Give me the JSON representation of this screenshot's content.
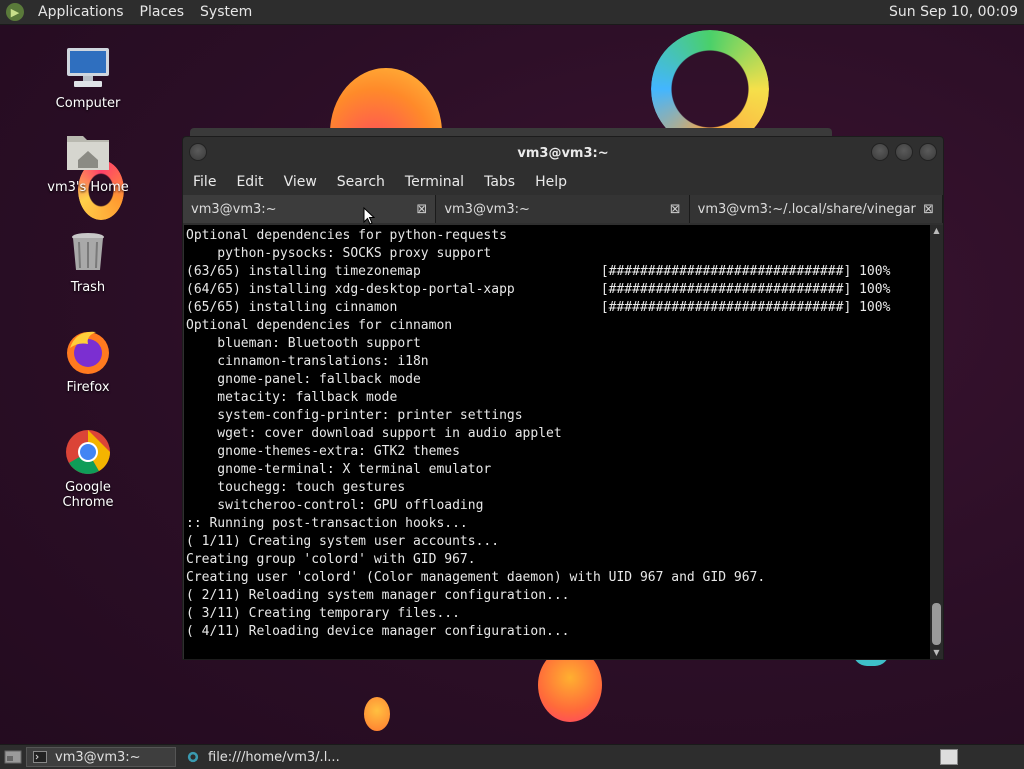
{
  "top_panel": {
    "menus": [
      "Applications",
      "Places",
      "System"
    ],
    "clock": "Sun Sep 10, 00:09"
  },
  "desktop_icons": [
    {
      "label": "Computer",
      "icon": "computer-icon"
    },
    {
      "label": "vm3's Home",
      "icon": "home-folder-icon"
    },
    {
      "label": "Trash",
      "icon": "trash-icon"
    },
    {
      "label": "Firefox",
      "icon": "firefox-icon"
    },
    {
      "label": "Google Chrome",
      "icon": "chrome-icon"
    }
  ],
  "terminal": {
    "title": "vm3@vm3:~",
    "menu": [
      "File",
      "Edit",
      "View",
      "Search",
      "Terminal",
      "Tabs",
      "Help"
    ],
    "tabs": [
      {
        "label": "vm3@vm3:~",
        "close": "⊠"
      },
      {
        "label": "vm3@vm3:~",
        "close": "⊠"
      },
      {
        "label": "vm3@vm3:~/.local/share/vinegar",
        "close": "⊠"
      }
    ],
    "lines": [
      "Optional dependencies for python-requests",
      "    python-pysocks: SOCKS proxy support",
      "(63/65) installing timezonemap                       [##############################] 100%",
      "(64/65) installing xdg-desktop-portal-xapp           [##############################] 100%",
      "(65/65) installing cinnamon                          [##############################] 100%",
      "Optional dependencies for cinnamon",
      "    blueman: Bluetooth support",
      "    cinnamon-translations: i18n",
      "    gnome-panel: fallback mode",
      "    metacity: fallback mode",
      "    system-config-printer: printer settings",
      "    wget: cover download support in audio applet",
      "    gnome-themes-extra: GTK2 themes",
      "    gnome-terminal: X terminal emulator",
      "    touchegg: touch gestures",
      "    switcheroo-control: GPU offloading",
      ":: Running post-transaction hooks...",
      "( 1/11) Creating system user accounts...",
      "Creating group 'colord' with GID 967.",
      "Creating user 'colord' (Color management daemon) with UID 967 and GID 967.",
      "( 2/11) Reloading system manager configuration...",
      "( 3/11) Creating temporary files...",
      "( 4/11) Reloading device manager configuration..."
    ]
  },
  "taskbar": {
    "tasks": [
      {
        "label": "vm3@vm3:~",
        "icon": "terminal-icon",
        "active": true
      },
      {
        "label": "file:///home/vm3/.l...",
        "icon": "browser-icon",
        "active": false
      }
    ]
  },
  "colors": {
    "panel": "#2d2d2d",
    "terminal_bg": "#000000",
    "terminal_fg": "#e8e8e8",
    "desktop": "#2b0e26"
  }
}
